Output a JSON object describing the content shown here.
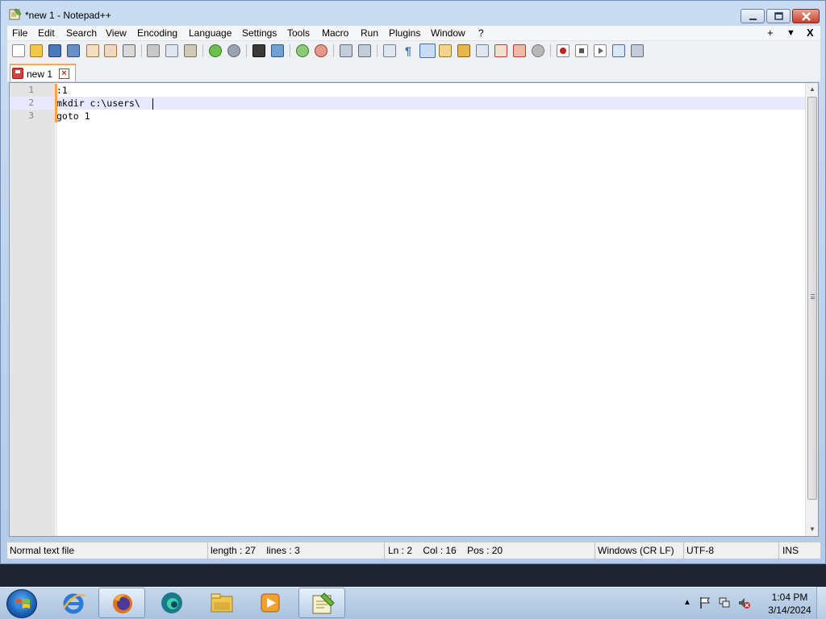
{
  "window": {
    "title": "*new 1 - Notepad++"
  },
  "menu": {
    "items": [
      "File",
      "Edit",
      "Search",
      "View",
      "Encoding",
      "Language",
      "Settings",
      "Tools",
      "Macro",
      "Run",
      "Plugins",
      "Window",
      "?"
    ],
    "right": [
      "+",
      "▼",
      "X"
    ]
  },
  "toolbar": {
    "icons": [
      "new-file-icon",
      "open-file-icon",
      "save-icon",
      "save-all-icon",
      "close-icon",
      "close-all-icon",
      "print-icon",
      "cut-icon",
      "copy-icon",
      "paste-icon",
      "undo-icon",
      "redo-icon",
      "find-icon",
      "replace-icon",
      "zoom-in-icon",
      "zoom-out-icon",
      "sync-vertical-icon",
      "sync-horizontal-icon",
      "word-wrap-icon",
      "show-all-chars-icon",
      "indent-guide-icon",
      "doc-map-icon",
      "function-list-icon",
      "folder-as-workspace-icon",
      "doc-switcher-icon",
      "monitor-icon",
      "macro-record-icon",
      "macro-stop-icon",
      "macro-play-icon",
      "macro-run-multiple-icon",
      "macro-save-icon"
    ]
  },
  "tabs": [
    {
      "label": "new 1",
      "modified": true
    }
  ],
  "editor": {
    "lines": [
      {
        "num": "1",
        "text": ":1"
      },
      {
        "num": "2",
        "text": "mkdir c:\\users\\"
      },
      {
        "num": "3",
        "text": "goto 1"
      }
    ],
    "current_line": 2
  },
  "status": {
    "file_type": "Normal text file",
    "length": "length : 27",
    "lines": "lines : 3",
    "ln": "Ln : 2",
    "col": "Col : 16",
    "pos": "Pos : 20",
    "eol": "Windows (CR LF)",
    "encoding": "UTF-8",
    "mode": "INS"
  },
  "taskbar": {
    "apps": [
      "internet-explorer-icon",
      "firefox-icon",
      "edge-icon",
      "file-explorer-icon",
      "media-player-icon",
      "notepad-plus-plus-icon"
    ],
    "active_app": "notepad-plus-plus-icon",
    "time": "1:04 PM",
    "date": "3/14/2024"
  },
  "colors": {
    "accent_orange": "#f7a84b",
    "current_line": "#e8e8ff",
    "taskbar_top": "#1e2530"
  }
}
